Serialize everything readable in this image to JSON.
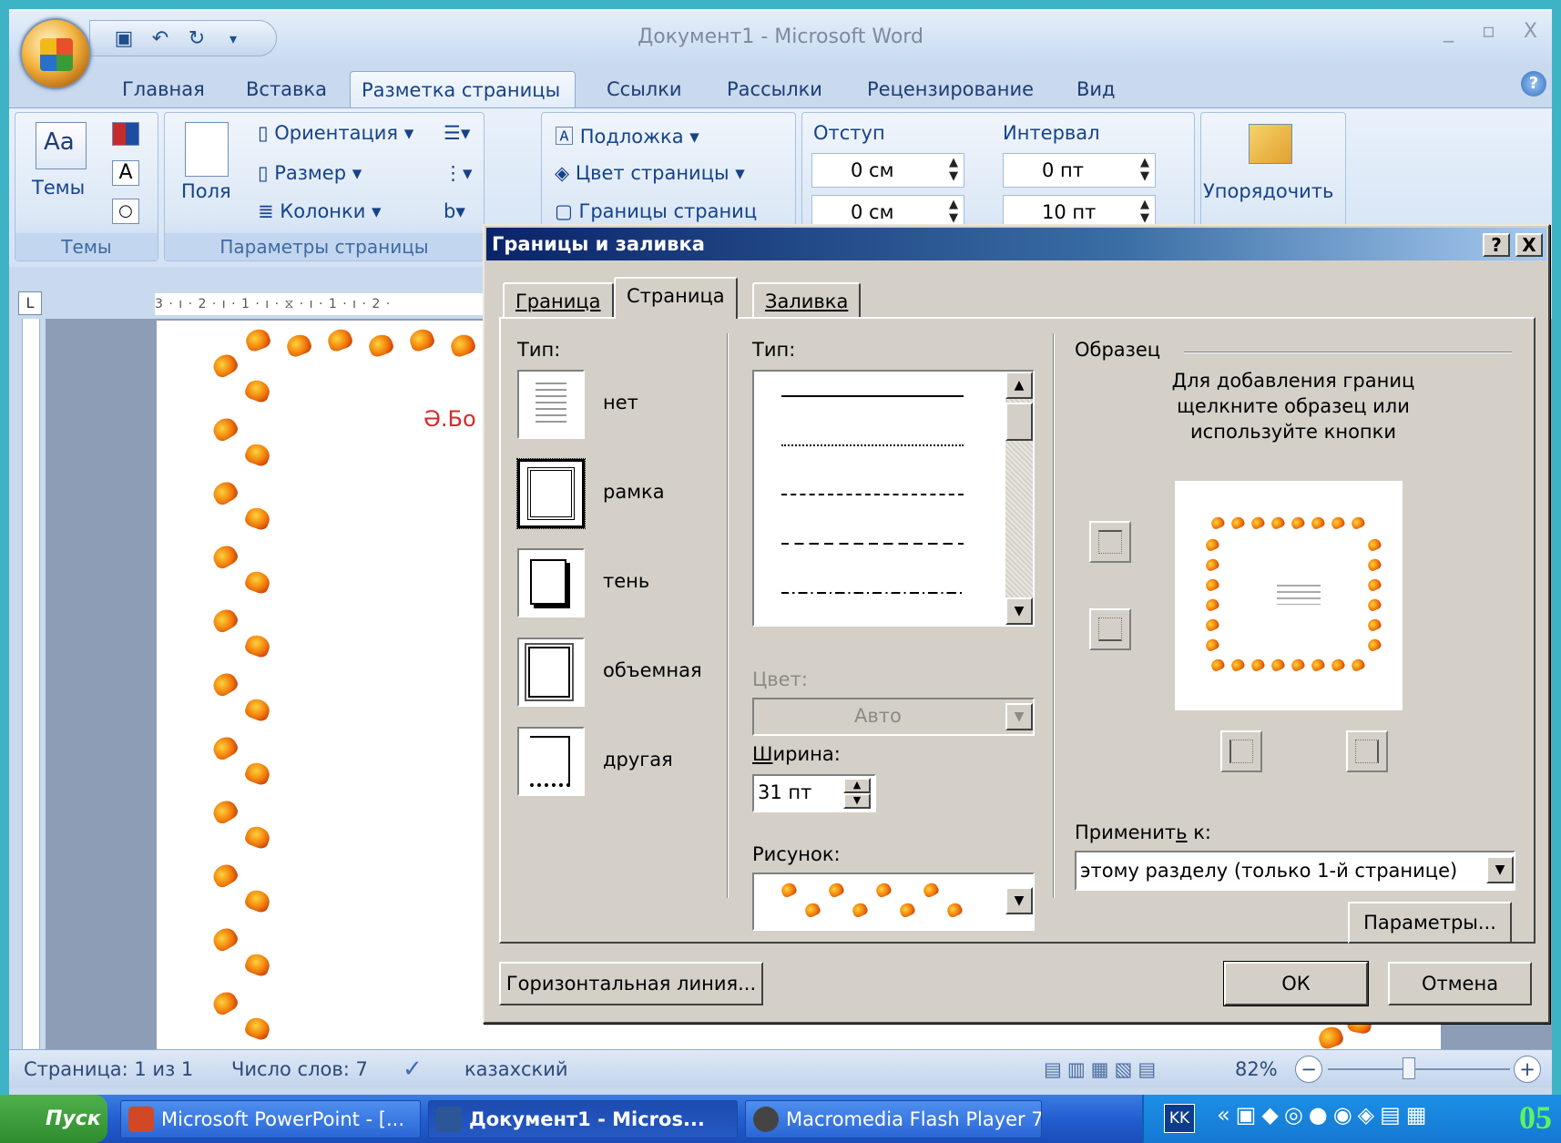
{
  "window": {
    "title": "Документ1 - Microsoft Word",
    "controls": "_ ▫ X"
  },
  "tabs": [
    "Главная",
    "Вставка",
    "Разметка страницы",
    "Ссылки",
    "Рассылки",
    "Рецензирование",
    "Вид"
  ],
  "active_tab": "Разметка страницы",
  "ribbon": {
    "themes_label": "Темы",
    "themes_group": "Темы",
    "fields_label": "Поля",
    "orientation": "Ориентация",
    "size": "Размер",
    "columns": "Колонки",
    "page_setup_group": "Параметры страницы",
    "watermark": "Подложка",
    "page_color": "Цвет страницы",
    "page_borders": "Границы страниц",
    "indent_label": "Отступ",
    "spacing_label": "Интервал",
    "indent_left": "0 см",
    "indent_right": "0 см",
    "spacing_before": "0 пт",
    "spacing_after": "10 пт",
    "arrange": "Упорядочить"
  },
  "ruler": {
    "h": "3 · ı · 2 · ı · 1 · ı · ⧖ · ı · 1 · ı · 2 ·",
    "corner": "L"
  },
  "document": {
    "partial_text": "Ә.Бо"
  },
  "dialog": {
    "title": "Границы и заливка",
    "help_btn": "?",
    "close_btn": "X",
    "tabs": [
      "Граница",
      "Страница",
      "Заливка"
    ],
    "active_tab": "Страница",
    "type_label": "Тип:",
    "types": [
      "нет",
      "рамка",
      "тень",
      "объемная",
      "другая"
    ],
    "selected_type": "рамка",
    "style_label": "Тип:",
    "color_label": "Цвет:",
    "color_value": "Авто",
    "width_label": "Ширина:",
    "width_value": "31 пт",
    "art_label": "Рисунок:",
    "preview_label": "Образец",
    "preview_hint": "Для добавления границ щелкните образец или используйте кнопки",
    "apply_label": "Применить к:",
    "apply_value": "этому разделу (только 1-й странице)",
    "options_btn": "Параметры...",
    "horizontal_line_btn": "Горизонтальная линия...",
    "ok_btn": "ОК",
    "cancel_btn": "Отмена"
  },
  "status": {
    "page": "Страница: 1 из 1",
    "words": "Число слов: 7",
    "language": "казахский",
    "zoom": "82%",
    "zoom_minus": "−",
    "zoom_plus": "+"
  },
  "taskbar": {
    "start": "Пуск",
    "items": [
      "Microsoft PowerPoint - [...",
      "Документ1 - Micros...",
      "Macromedia Flash Player 7"
    ],
    "lang": "KK",
    "clock": "05"
  }
}
